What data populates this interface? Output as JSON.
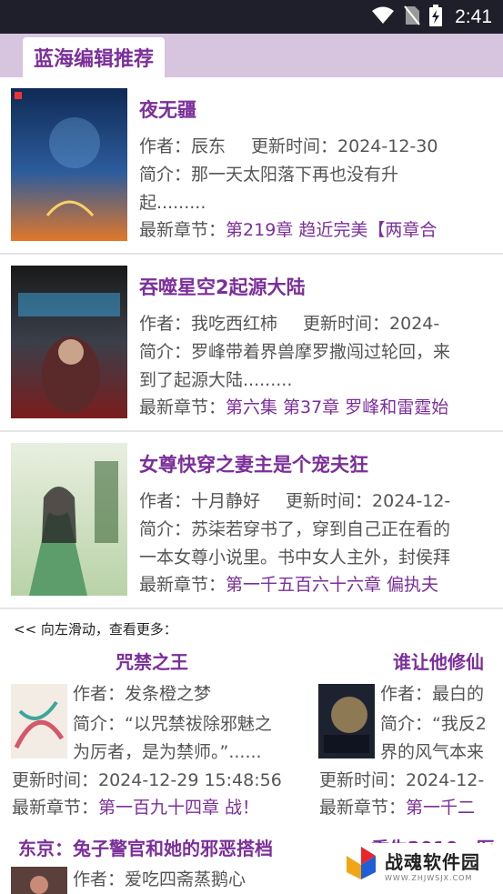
{
  "status": {
    "time": "2:41"
  },
  "section": {
    "title": "蓝海编辑推荐"
  },
  "books": [
    {
      "title": "夜无疆",
      "author": "作者：辰东",
      "updated": "更新时间：2024-12-30",
      "intro1": "简介：那一天太阳落下再也没有升",
      "intro2": "起.........",
      "chapter_label": "最新章节：",
      "chapter": "第219章 趋近完美【两章合"
    },
    {
      "title": "吞噬星空2起源大陆",
      "author": "作者：我吃西红柿",
      "updated": "更新时间：2024-",
      "intro1": "简介：罗峰带着界兽摩罗撒闯过轮回，来",
      "intro2": "到了起源大陆.........",
      "chapter_label": "最新章节：",
      "chapter": "第六集 第37章 罗峰和雷霆始"
    },
    {
      "title": "女尊快穿之妻主是个宠夫狂",
      "author": "作者：十月静好",
      "updated": "更新时间：2024-12-",
      "intro1": "简介：苏柒若穿书了，穿到自己正在看的",
      "intro2": "一本女尊小说里。书中女人主外，封侯拜",
      "chapter_label": "最新章节：",
      "chapter": "第一千五百六十六章 偏执夫"
    }
  ],
  "hint": "<< 向左滑动，查看更多：",
  "cards": [
    {
      "title": "咒禁之王",
      "author": "作者：发条橙之梦",
      "intro1": "简介：“以咒禁祓除邪魅之",
      "intro2": "为厉者，是为禁师。”......",
      "updated": "更新时间：2024-12-29 15:48:56",
      "chapter_label": "最新章节：",
      "chapter": "第一百九十四章 战！"
    },
    {
      "title": "谁让他修仙",
      "author": "作者：最白的",
      "intro1": "简介：“我反2",
      "intro2": "界的风气本来",
      "updated": "更新时间：2024-12-",
      "chapter_label": "最新章节：",
      "chapter": "第一千二"
    }
  ],
  "partial": {
    "title_left": "东京：兔子警官和她的邪恶搭档",
    "author_left": "作者：爱吃四斋蒸鹅心",
    "title_right": "重生2010，医"
  },
  "watermark": {
    "name": "战魂软件园",
    "url": "WWW.ZHJWSJX.COM"
  },
  "colors": {
    "accent": "#7b2f9a",
    "band": "#d7c4df",
    "statusbar": "#1f1f2b"
  }
}
